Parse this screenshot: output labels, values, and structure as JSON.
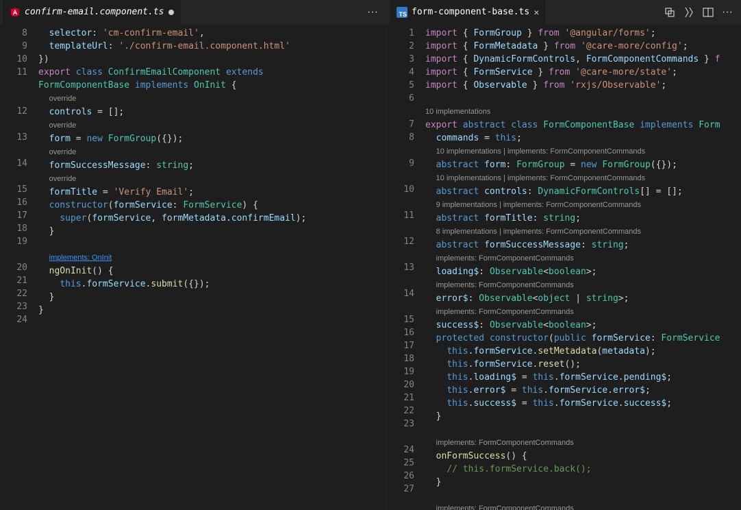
{
  "left": {
    "tab": {
      "name": "confirm-email.component.ts",
      "dirty": true
    },
    "lines": [
      {
        "n": 8,
        "t": "  <span class='prop'>selector</span><span class='punc'>: </span><span class='str'>'cm-confirm-email'</span><span class='punc'>,</span>"
      },
      {
        "n": 9,
        "t": "  <span class='prop'>templateUrl</span><span class='punc'>: </span><span class='str'>'./confirm-email.component.html'</span>"
      },
      {
        "n": 10,
        "t": "<span class='punc'>})</span>"
      },
      {
        "n": 11,
        "t": "<span class='kw2'>export</span> <span class='kw'>class</span> <span class='type'>ConfirmEmailComponent</span> <span class='kw'>extends</span>"
      },
      {
        "n": "",
        "t": "<span class='type'>FormComponentBase</span> <span class='kw'>implements</span> <span class='type'>OnInit</span> <span class='punc'>{</span>"
      },
      {
        "n": "",
        "cl": true,
        "t": "  <span class='codelens'>override</span>"
      },
      {
        "n": 12,
        "t": "  <span class='prop'>controls</span> <span class='punc'>= [];</span>"
      },
      {
        "n": "",
        "cl": true,
        "t": "  <span class='codelens'>override</span>"
      },
      {
        "n": 13,
        "t": "  <span class='prop'>form</span> <span class='punc'>=</span> <span class='kw'>new</span> <span class='type'>FormGroup</span><span class='punc'>({});</span>"
      },
      {
        "n": "",
        "cl": true,
        "t": "  <span class='codelens'>override</span>"
      },
      {
        "n": 14,
        "t": "  <span class='prop'>formSuccessMessage</span><span class='punc'>:</span> <span class='type'>string</span><span class='punc'>;</span>"
      },
      {
        "n": "",
        "cl": true,
        "t": "  <span class='codelens'>override</span>"
      },
      {
        "n": 15,
        "t": "  <span class='prop'>formTitle</span> <span class='punc'>=</span> <span class='str'>'Verify Email'</span><span class='punc'>;</span>"
      },
      {
        "n": 16,
        "t": "  <span class='kw'>constructor</span><span class='punc'>(</span><span class='var'>formService</span><span class='punc'>:</span> <span class='type'>FormService</span><span class='punc'>) {</span>"
      },
      {
        "n": 17,
        "t": "    <span class='kw'>super</span><span class='punc'>(</span><span class='var'>formService</span><span class='punc'>,</span> <span class='var'>formMetadata</span><span class='punc'>.</span><span class='prop'>confirmEmail</span><span class='punc'>);</span>"
      },
      {
        "n": 18,
        "t": "  <span class='punc'>}</span>"
      },
      {
        "n": 19,
        "t": ""
      },
      {
        "n": "",
        "cl": true,
        "t": "  <span class='link'>implements: OnInit</span>"
      },
      {
        "n": 20,
        "t": "  <span class='func'>ngOnInit</span><span class='punc'>() {</span>"
      },
      {
        "n": 21,
        "t": "    <span class='kw'>this</span><span class='punc'>.</span><span class='var'>formService</span><span class='punc'>.</span><span class='func'>submit</span><span class='punc'>({});</span>"
      },
      {
        "n": 22,
        "t": "  <span class='punc'>}</span>"
      },
      {
        "n": 23,
        "t": "<span class='punc'>}</span>"
      },
      {
        "n": 24,
        "t": ""
      }
    ]
  },
  "right": {
    "tab": {
      "name": "form-component-base.ts",
      "close": "×"
    },
    "lines": [
      {
        "n": 1,
        "t": "<span class='kw2'>import</span> <span class='punc'>{ </span><span class='var'>FormGroup</span><span class='punc'> }</span> <span class='kw2'>from</span> <span class='str'>'@angular/forms'</span><span class='punc'>;</span>"
      },
      {
        "n": 2,
        "t": "<span class='kw2'>import</span> <span class='punc'>{ </span><span class='var'>FormMetadata</span><span class='punc'> }</span> <span class='kw2'>from</span> <span class='str'>'@care-more/config'</span><span class='punc'>;</span>"
      },
      {
        "n": 3,
        "t": "<span class='kw2'>import</span> <span class='punc'>{ </span><span class='var'>DynamicFormControls</span><span class='punc'>, </span><span class='var'>FormComponentCommands</span><span class='punc'> }</span> <span class='kw2'>f</span>"
      },
      {
        "n": 4,
        "t": "<span class='kw2'>import</span> <span class='punc'>{ </span><span class='var'>FormService</span><span class='punc'> }</span> <span class='kw2'>from</span> <span class='str'>'@care-more/state'</span><span class='punc'>;</span>"
      },
      {
        "n": 5,
        "t": "<span class='kw2'>import</span> <span class='punc'>{ </span><span class='var'>Observable</span><span class='punc'> }</span> <span class='kw2'>from</span> <span class='str'>'rxjs/Observable'</span><span class='punc'>;</span>"
      },
      {
        "n": 6,
        "t": ""
      },
      {
        "n": "",
        "cl": true,
        "t": "<span class='codelens'>10 implementations</span>"
      },
      {
        "n": 7,
        "t": "<span class='kw2'>export</span> <span class='kw'>abstract</span> <span class='kw'>class</span> <span class='type'>FormComponentBase</span> <span class='kw'>implements</span> <span class='type'>Form</span>"
      },
      {
        "n": 8,
        "t": "  <span class='prop'>commands</span> <span class='punc'>=</span> <span class='kw'>this</span><span class='punc'>;</span>"
      },
      {
        "n": "",
        "cl": true,
        "t": "  <span class='codelens'>10 implementations | implements: FormComponentCommands</span>"
      },
      {
        "n": 9,
        "t": "  <span class='kw'>abstract</span> <span class='prop'>form</span><span class='punc'>:</span> <span class='type'>FormGroup</span> <span class='punc'>=</span> <span class='kw'>new</span> <span class='type'>FormGroup</span><span class='punc'>({});</span>"
      },
      {
        "n": "",
        "cl": true,
        "t": "  <span class='codelens'>10 implementations | implements: FormComponentCommands</span>"
      },
      {
        "n": 10,
        "t": "  <span class='kw'>abstract</span> <span class='prop'>controls</span><span class='punc'>:</span> <span class='type'>DynamicFormControls</span><span class='punc'>[] = [];</span>"
      },
      {
        "n": "",
        "cl": true,
        "t": "  <span class='codelens'>9 implementations | implements: FormComponentCommands</span>"
      },
      {
        "n": 11,
        "t": "  <span class='kw'>abstract</span> <span class='prop'>formTitle</span><span class='punc'>:</span> <span class='type'>string</span><span class='punc'>;</span>"
      },
      {
        "n": "",
        "cl": true,
        "t": "  <span class='codelens'>8 implementations | implements: FormComponentCommands</span>"
      },
      {
        "n": 12,
        "t": "  <span class='kw'>abstract</span> <span class='prop'>formSuccessMessage</span><span class='punc'>:</span> <span class='type'>string</span><span class='punc'>;</span>"
      },
      {
        "n": "",
        "cl": true,
        "t": "  <span class='codelens'>implements: FormComponentCommands</span>"
      },
      {
        "n": 13,
        "t": "  <span class='prop'>loading$</span><span class='punc'>:</span> <span class='type'>Observable</span><span class='punc'>&lt;</span><span class='type'>boolean</span><span class='punc'>&gt;;</span>"
      },
      {
        "n": "",
        "cl": true,
        "t": "  <span class='codelens'>implements: FormComponentCommands</span>"
      },
      {
        "n": 14,
        "t": "  <span class='prop'>error$</span><span class='punc'>:</span> <span class='type'>Observable</span><span class='punc'>&lt;</span><span class='type'>object</span> <span class='punc'>|</span> <span class='type'>string</span><span class='punc'>&gt;;</span>"
      },
      {
        "n": "",
        "cl": true,
        "t": "  <span class='codelens'>implements: FormComponentCommands</span>"
      },
      {
        "n": 15,
        "t": "  <span class='prop'>success$</span><span class='punc'>:</span> <span class='type'>Observable</span><span class='punc'>&lt;</span><span class='type'>boolean</span><span class='punc'>&gt;;</span>"
      },
      {
        "n": 16,
        "t": "  <span class='kw'>protected</span> <span class='kw'>constructor</span><span class='punc'>(</span><span class='kw'>public</span> <span class='var'>formService</span><span class='punc'>:</span> <span class='type'>FormService</span>"
      },
      {
        "n": 17,
        "t": "    <span class='kw'>this</span><span class='punc'>.</span><span class='var'>formService</span><span class='punc'>.</span><span class='func'>setMetadata</span><span class='punc'>(</span><span class='var'>metadata</span><span class='punc'>);</span>"
      },
      {
        "n": 18,
        "t": "    <span class='kw'>this</span><span class='punc'>.</span><span class='var'>formService</span><span class='punc'>.</span><span class='func'>reset</span><span class='punc'>();</span>"
      },
      {
        "n": 19,
        "t": "    <span class='kw'>this</span><span class='punc'>.</span><span class='var'>loading$</span> <span class='punc'>=</span> <span class='kw'>this</span><span class='punc'>.</span><span class='var'>formService</span><span class='punc'>.</span><span class='var'>pending$</span><span class='punc'>;</span>"
      },
      {
        "n": 20,
        "t": "    <span class='kw'>this</span><span class='punc'>.</span><span class='var'>error$</span> <span class='punc'>=</span> <span class='kw'>this</span><span class='punc'>.</span><span class='var'>formService</span><span class='punc'>.</span><span class='var'>error$</span><span class='punc'>;</span>"
      },
      {
        "n": 21,
        "t": "    <span class='kw'>this</span><span class='punc'>.</span><span class='var'>success$</span> <span class='punc'>=</span> <span class='kw'>this</span><span class='punc'>.</span><span class='var'>formService</span><span class='punc'>.</span><span class='var'>success$</span><span class='punc'>;</span>"
      },
      {
        "n": 22,
        "t": "  <span class='punc'>}</span>"
      },
      {
        "n": 23,
        "t": ""
      },
      {
        "n": "",
        "cl": true,
        "t": "  <span class='codelens'>implements: FormComponentCommands</span>"
      },
      {
        "n": 24,
        "t": "  <span class='func'>onFormSuccess</span><span class='punc'>() {</span>"
      },
      {
        "n": 25,
        "t": "    <span class='cmt'>// this.formService.back();</span>"
      },
      {
        "n": 26,
        "t": "  <span class='punc'>}</span>"
      },
      {
        "n": 27,
        "t": ""
      },
      {
        "n": "",
        "cl": true,
        "t": "  <span class='codelens'>implements: FormComponentCommands</span>"
      }
    ]
  }
}
